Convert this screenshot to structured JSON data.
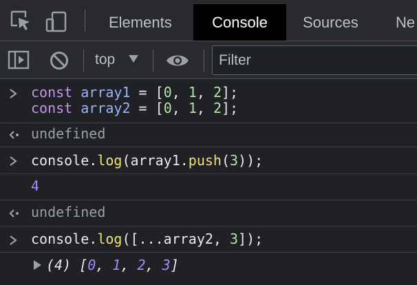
{
  "tabs": [
    {
      "label": "Elements"
    },
    {
      "label": "Console"
    },
    {
      "label": "Sources"
    },
    {
      "label": "Ne"
    }
  ],
  "toolbar": {
    "context": "top",
    "filter_placeholder": "Filter"
  },
  "console": {
    "entry1": {
      "line1": {
        "kw": "const",
        "name": "array1",
        "eq": " = ",
        "open": "[",
        "n0": "0",
        "c1": ", ",
        "n1": "1",
        "c2": ", ",
        "n2": "2",
        "close": "];"
      },
      "line2": {
        "kw": "const",
        "name": "array2",
        "eq": " = ",
        "open": "[",
        "n0": "0",
        "c1": ", ",
        "n1": "1",
        "c2": ", ",
        "n2": "2",
        "close": "];"
      }
    },
    "result1": "undefined",
    "entry2": {
      "obj": "console.",
      "fn": "log",
      "p1": "(array1.",
      "fn2": "push",
      "p2": "(",
      "num": "3",
      "p3": "));"
    },
    "log1": "4",
    "result2": "undefined",
    "entry3": {
      "obj": "console.",
      "fn": "log",
      "p1": "([...array2, ",
      "num": "3",
      "p2": "]);"
    },
    "log2": {
      "count": "(4)",
      "open": "[",
      "v0": "0",
      "s1": ", ",
      "v1": "1",
      "s2": ", ",
      "v2": "2",
      "s3": ", ",
      "v3": "3",
      "close": "]"
    }
  },
  "colors": {
    "background": "#202124",
    "toolbar": "#292a2d",
    "active_tab": "#000000",
    "keyword": "#c792ea",
    "variable": "#9ab4f8",
    "number": "#b1e6a6",
    "function": "#f1e07a",
    "result": "#9e8cff"
  }
}
